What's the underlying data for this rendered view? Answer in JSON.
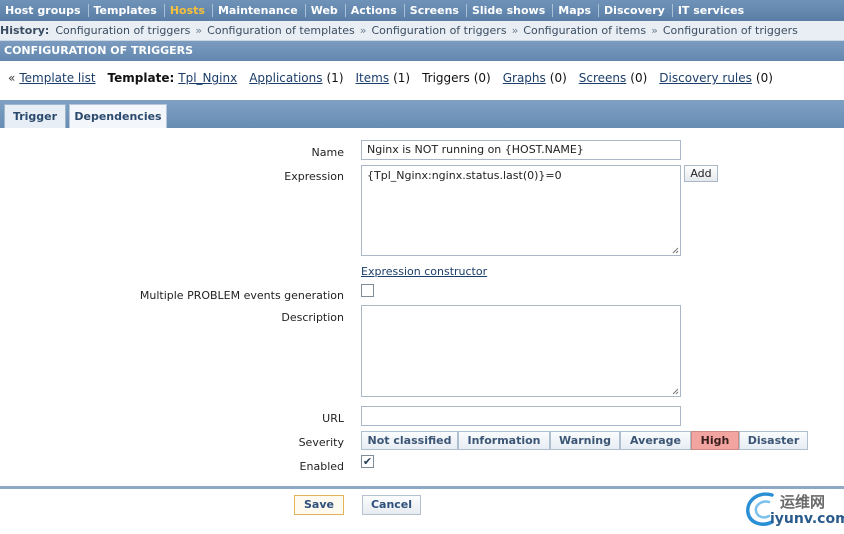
{
  "top_nav": [
    "Host groups",
    "Templates",
    "Hosts",
    "Maintenance",
    "Web",
    "Actions",
    "Screens",
    "Slide shows",
    "Maps",
    "Discovery",
    "IT services"
  ],
  "top_nav_active_index": 2,
  "history": {
    "label": "History:",
    "items": [
      "Configuration of triggers",
      "Configuration of templates",
      "Configuration of triggers",
      "Configuration of items",
      "Configuration of triggers"
    ],
    "separator": "»"
  },
  "section_title": "CONFIGURATION OF TRIGGERS",
  "template_nav": {
    "back_marker": "«",
    "template_list": "Template list",
    "template_label": "Template:",
    "template_name": "Tpl_Nginx",
    "applications": "Applications",
    "applications_count": "(1)",
    "items": "Items",
    "items_count": "(1)",
    "triggers": "Triggers",
    "triggers_count": "(0)",
    "graphs": "Graphs",
    "graphs_count": "(0)",
    "screens": "Screens",
    "screens_count": "(0)",
    "discovery_rules": "Discovery rules",
    "discovery_rules_count": "(0)"
  },
  "tabs": [
    "Trigger",
    "Dependencies"
  ],
  "form": {
    "name_label": "Name",
    "name_value": "Nginx is NOT running on {HOST.NAME}",
    "expression_label": "Expression",
    "expression_value": "{Tpl_Nginx:nginx.status.last(0)}=0",
    "add_button": "Add",
    "expression_constructor": "Expression constructor",
    "multiple_events_label": "Multiple PROBLEM events generation",
    "multiple_events_checked": false,
    "description_label": "Description",
    "description_value": "",
    "url_label": "URL",
    "url_value": "",
    "severity_label": "Severity",
    "severity_options": [
      "Not classified",
      "Information",
      "Warning",
      "Average",
      "High",
      "Disaster"
    ],
    "severity_selected": "High",
    "enabled_label": "Enabled",
    "enabled_checked": true,
    "enabled_check_glyph": "✔"
  },
  "footer": {
    "save": "Save",
    "cancel": "Cancel"
  },
  "watermark": {
    "chinese": "运维网",
    "domain": "iyunv.com"
  },
  "colors": {
    "nav_bg": "#6383a8",
    "active_nav": "#f5c03a",
    "severity_high": "#f2a4a0"
  }
}
